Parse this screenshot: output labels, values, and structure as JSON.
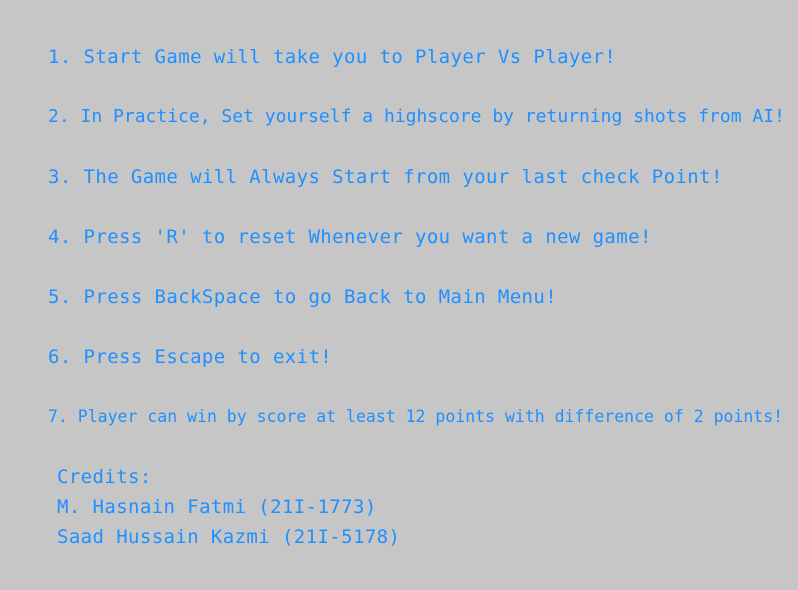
{
  "instructions": [
    "1. Start Game will take you to Player Vs Player!",
    "2. In Practice, Set yourself a highscore by returning shots from AI!",
    "3. The Game will Always Start from your last check Point!",
    "4. Press 'R' to reset Whenever you want a new game!",
    "5. Press BackSpace to go Back to Main Menu!",
    "6. Press Escape to exit!",
    "7. Player can win by score at least 12 points with difference of 2 points!"
  ],
  "credits": {
    "heading": "Credits:",
    "authors": [
      "M. Hasnain Fatmi  (21I-1773)",
      "Saad Hussain Kazmi (21I-5178)"
    ]
  },
  "colors": {
    "background": "#c6c6c6",
    "text": "#1e90ff"
  }
}
